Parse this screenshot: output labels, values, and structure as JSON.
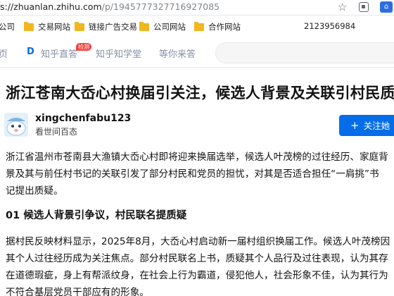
{
  "browser": {
    "url_host": "s://zhuanlan.zhihu.com",
    "url_path": "/p/1945777327716927085"
  },
  "bookmarks": {
    "items": [
      {
        "label": "公司",
        "folder": false
      },
      {
        "label": "交易网站",
        "folder": true
      },
      {
        "label": "链接广告交易",
        "folder": true
      },
      {
        "label": "公司网站",
        "folder": true
      },
      {
        "label": "合作网站",
        "folder": true
      }
    ],
    "number": "2123956984"
  },
  "nav": {
    "home": "页",
    "zhida": "知乎直答",
    "zhida_badge": "检测",
    "learn": "知乎知学堂",
    "wait": "等你来答"
  },
  "article": {
    "title": "浙江苍南大岙心村换届引关注，候选人背景及关联引村民质疑",
    "author_name": "xingchenfabu123",
    "author_desc": "看世间百态",
    "follow_label": "关注她",
    "para1_lines": [
      "浙江省温州市苍南县大渔镇大岙心村即将迎来换届选举，候选人叶茂榜的过往经历、家庭背",
      "景及其与前任村书记的关联引发了部分村民和党员的担忧，对其是否适合担任“一肩挑”书",
      "记提出质疑。"
    ],
    "section1_heading": "01 候选人背景引争议，村民联名提质疑",
    "para2_lines": [
      "据村民反映材料显示，2025年8月，大岙心村启动新一届村组织换届工作。候选人叶茂榜因",
      "其个人过往经历成为关注焦点。部分村民联名上书，质疑其个人品行及过往表现，认为其存",
      "在道德瑕疵，身上有帮派纹身，在社会上行为霸道，侵犯他人，社会形象不佳，认为其行为",
      "不符合基层党员干部应有的形象。"
    ]
  },
  "colors": {
    "accent": "#056de8",
    "badge": "#f1403c",
    "folder": "#f2b61e"
  }
}
